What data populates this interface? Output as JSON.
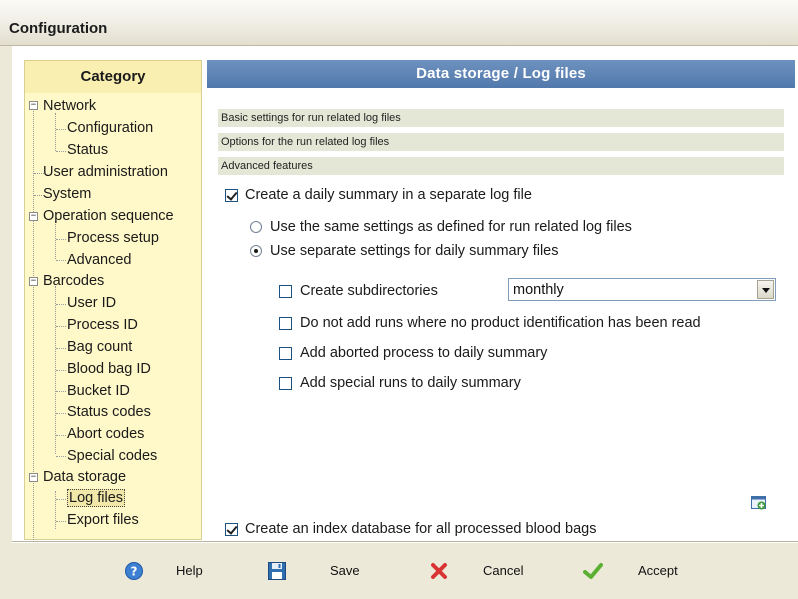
{
  "window": {
    "title": "Configuration"
  },
  "sidebar": {
    "header": "Category",
    "items": [
      {
        "label": "Network",
        "expanded": true
      },
      {
        "label": "Configuration"
      },
      {
        "label": "Status"
      },
      {
        "label": "User administration"
      },
      {
        "label": "System"
      },
      {
        "label": "Operation sequence",
        "expanded": true
      },
      {
        "label": "Process setup"
      },
      {
        "label": "Advanced"
      },
      {
        "label": "Barcodes",
        "expanded": true
      },
      {
        "label": "User ID"
      },
      {
        "label": "Process ID"
      },
      {
        "label": "Bag count"
      },
      {
        "label": "Blood bag ID"
      },
      {
        "label": "Bucket ID"
      },
      {
        "label": "Status codes"
      },
      {
        "label": "Abort codes"
      },
      {
        "label": "Special codes"
      },
      {
        "label": "Data storage",
        "expanded": true
      },
      {
        "label": "Log files",
        "selected": true
      },
      {
        "label": "Export files"
      }
    ]
  },
  "panel": {
    "title": "Data storage / Log files",
    "sections": [
      "Basic settings for run related log files",
      "Options for the run related log files",
      "Advanced features"
    ],
    "daily_summary": {
      "label": "Create a daily summary in a separate log file",
      "checked": true
    },
    "radio_same": {
      "label": "Use the same settings as defined for run related log files",
      "selected": false
    },
    "radio_separate": {
      "label": "Use separate settings for daily summary files",
      "selected": true
    },
    "subdirs": {
      "label": "Create subdirectories",
      "checked": false,
      "select_value": "monthly"
    },
    "no_product": {
      "label": "Do not add runs where no product identification has been read",
      "checked": false
    },
    "aborted": {
      "label": "Add aborted process to daily summary",
      "checked": false
    },
    "special_runs": {
      "label": "Add special runs to daily summary",
      "checked": false
    },
    "index_db": {
      "label": "Create an index database for all processed blood bags",
      "checked": true
    }
  },
  "buttons": {
    "help": "Help",
    "save": "Save",
    "cancel": "Cancel",
    "accept": "Accept"
  },
  "colors": {
    "panel_header": "#5f86b7",
    "sidebar_bg": "#fff8c8",
    "section_bar": "#e4e7d6"
  }
}
